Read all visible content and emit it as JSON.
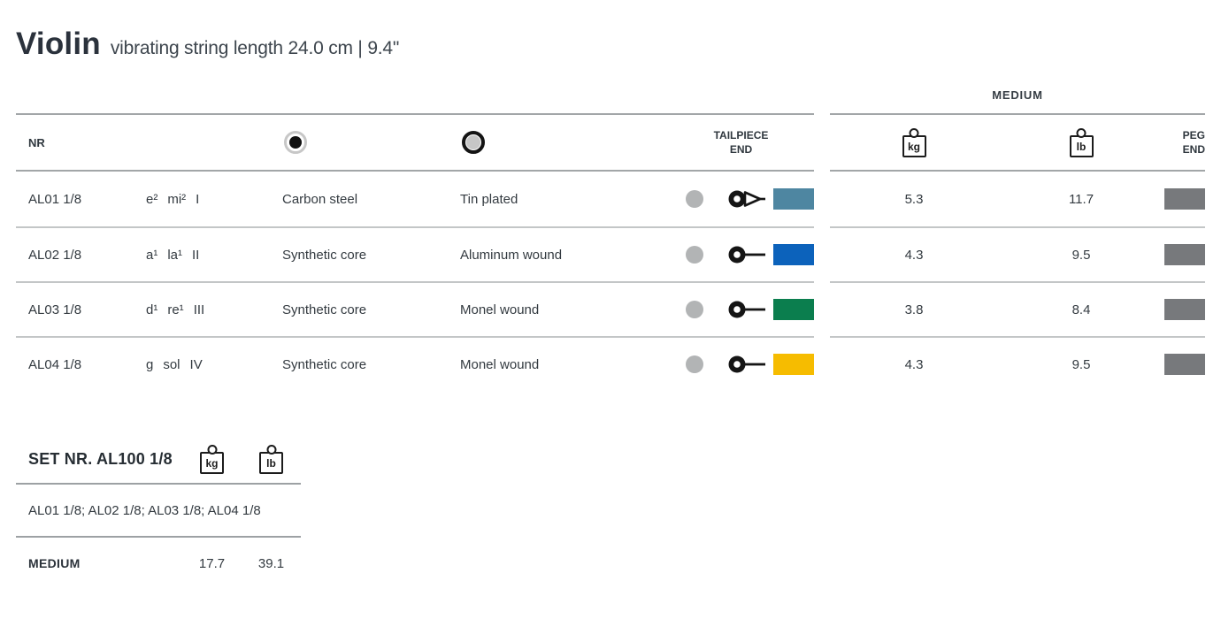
{
  "page": {
    "title": "Violin",
    "subtitle": "vibrating string length 24.0 cm | 9.4\""
  },
  "table": {
    "gauge_label": "MEDIUM",
    "headers": {
      "nr": "NR",
      "core_icon": "string-core-icon",
      "winding_icon": "string-winding-icon",
      "tailpiece": "TAILPIECE\nEND",
      "kg_icon_label": "kg",
      "lb_icon_label": "lb",
      "peg": "PEG\nEND"
    },
    "peg_color": "#77797c",
    "tailpiece_dot_color": "#b2b4b5",
    "rows": [
      {
        "nr": "AL01 1/8",
        "pitch": "e²",
        "solfege": "mi²",
        "roman": "I",
        "core": "Carbon steel",
        "winding": "Tin plated",
        "end_type": "loop",
        "tailpiece_color": "#4e86a1",
        "kg": "5.3",
        "lb": "11.7"
      },
      {
        "nr": "AL02 1/8",
        "pitch": "a¹",
        "solfege": "la¹",
        "roman": "II",
        "core": "Synthetic core",
        "winding": "Aluminum wound",
        "end_type": "ball",
        "tailpiece_color": "#0c62bb",
        "kg": "4.3",
        "lb": "9.5"
      },
      {
        "nr": "AL03 1/8",
        "pitch": "d¹",
        "solfege": "re¹",
        "roman": "III",
        "core": "Synthetic core",
        "winding": "Monel wound",
        "end_type": "ball",
        "tailpiece_color": "#0b7e4e",
        "kg": "3.8",
        "lb": "8.4"
      },
      {
        "nr": "AL04 1/8",
        "pitch": "g",
        "solfege": "sol",
        "roman": "IV",
        "core": "Synthetic core",
        "winding": "Monel wound",
        "end_type": "ball",
        "tailpiece_color": "#f6bc00",
        "kg": "4.3",
        "lb": "9.5"
      }
    ]
  },
  "set": {
    "title": "SET NR. AL100 1/8",
    "kg_icon_label": "kg",
    "lb_icon_label": "lb",
    "contents": "AL01 1/8; AL02 1/8; AL03 1/8; AL04 1/8",
    "tension_label": "MEDIUM",
    "kg_total": "17.7",
    "lb_total": "39.1"
  }
}
